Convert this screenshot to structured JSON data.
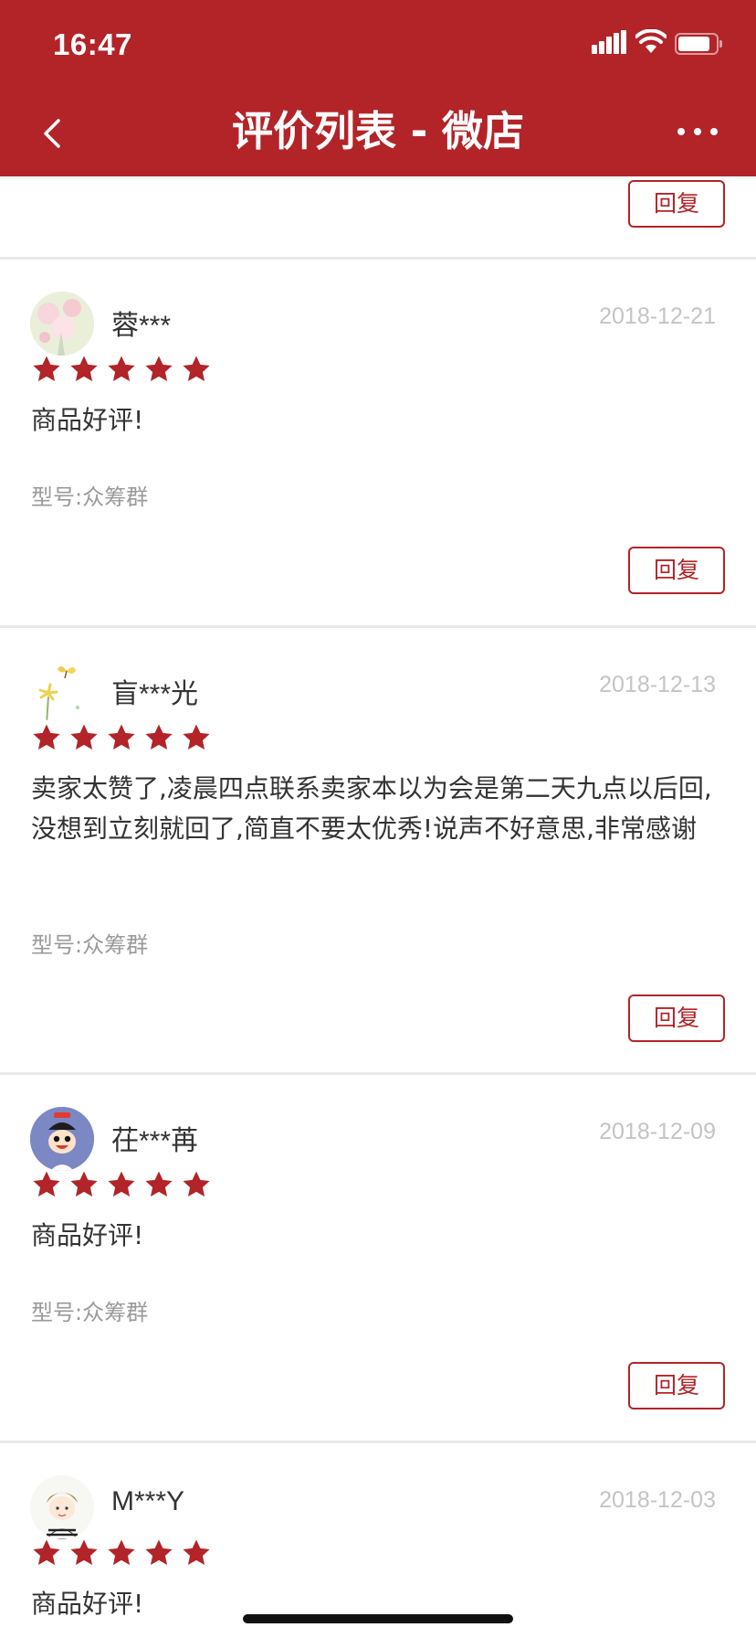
{
  "status_bar": {
    "time": "16:47"
  },
  "header": {
    "title": "评价列表 - 微店",
    "back_icon": "chevron-left-icon",
    "more_icon": "more-icon"
  },
  "colors": {
    "brand": "#b22428",
    "star": "#b22428",
    "muted": "#9a9a9a",
    "date": "#c4c4c4"
  },
  "partial_review": {
    "reply_label": "回复"
  },
  "reviews": [
    {
      "username": "蓉***",
      "date": "2018-12-21",
      "rating": 5,
      "comment": "商品好评!",
      "model": "型号:众筹群",
      "reply_label": "回复",
      "avatar": "blossom-avatar"
    },
    {
      "username": "盲***光",
      "date": "2018-12-13",
      "rating": 5,
      "comment": "卖家太赞了,凌晨四点联系卖家本以为会是第二天九点以后回,没想到立刻就回了,简直不要太优秀!说声不好意思,非常感谢",
      "model": "型号:众筹群",
      "reply_label": "回复",
      "avatar": "butterfly-flower-avatar"
    },
    {
      "username": "茌***苒",
      "date": "2018-12-09",
      "rating": 5,
      "comment": "商品好评!",
      "model": "型号:众筹群",
      "reply_label": "回复",
      "avatar": "cartoon-boy-avatar"
    },
    {
      "username": "M***Y",
      "date": "2018-12-03",
      "rating": 5,
      "comment": "商品好评!",
      "model": "",
      "reply_label": "",
      "avatar": "sketch-boy-avatar"
    }
  ]
}
